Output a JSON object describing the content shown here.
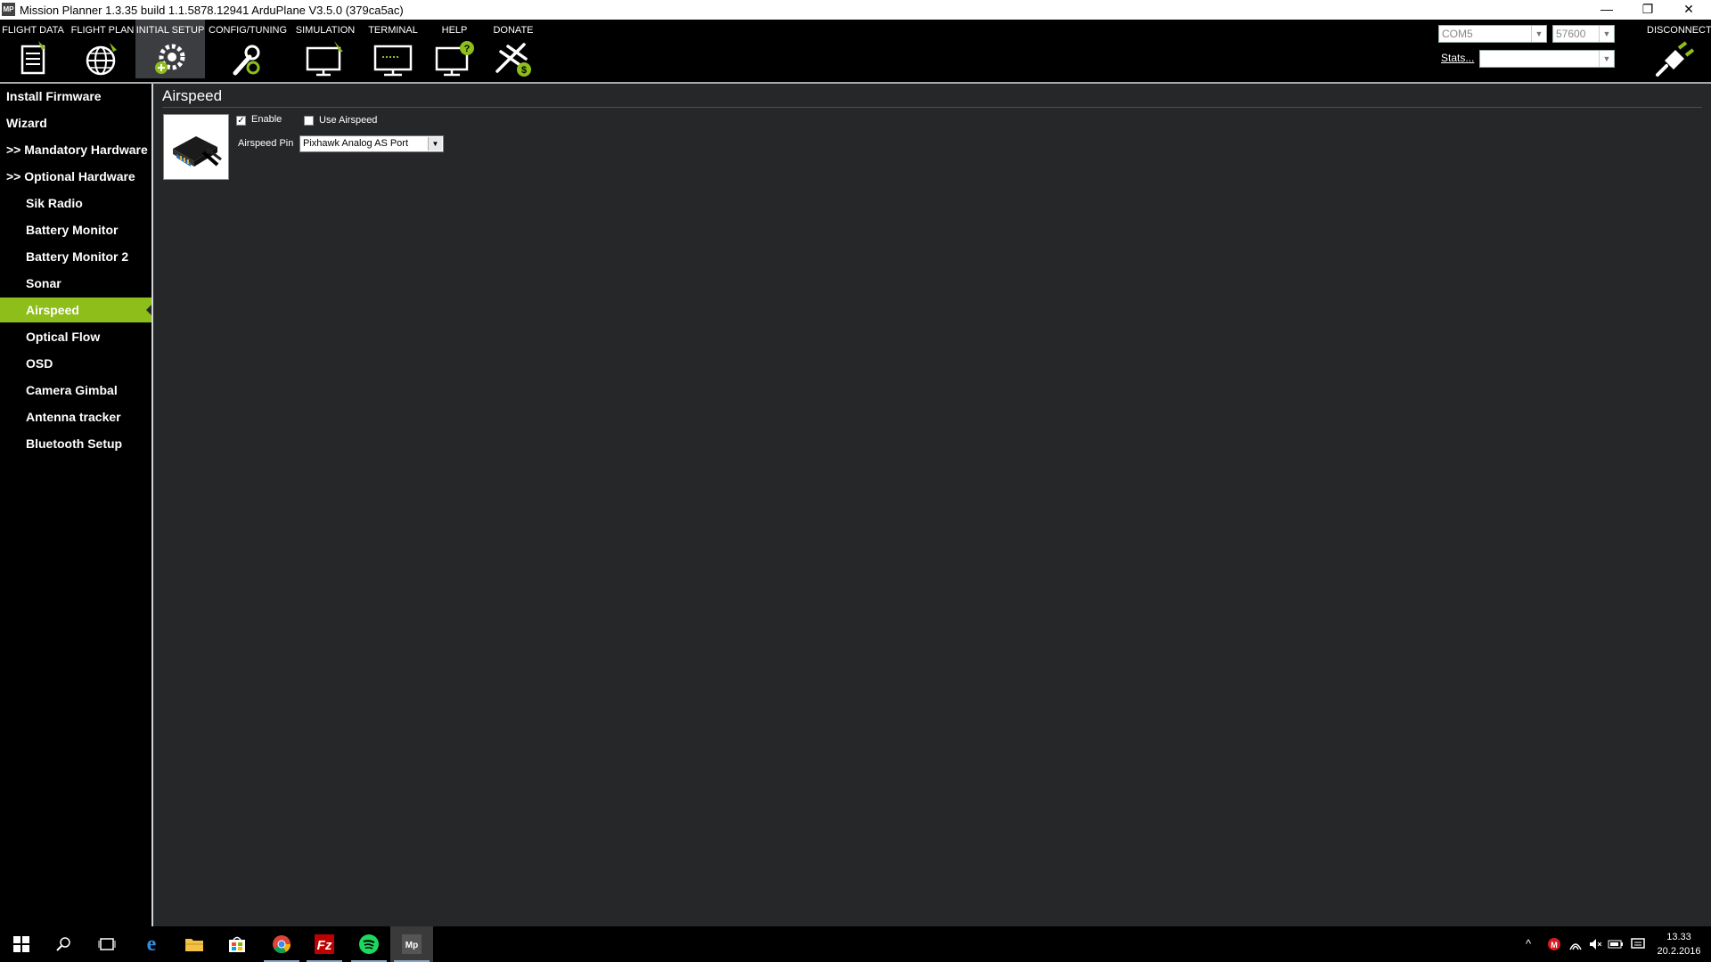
{
  "window": {
    "title": "Mission Planner 1.3.35 build 1.1.5878.12941 ArduPlane V3.5.0 (379ca5ac)",
    "app_icon_text": "MP",
    "minimize": "—",
    "restore": "❐",
    "close": "✕"
  },
  "toolbar": {
    "menu": [
      {
        "label": "FLIGHT DATA",
        "icon": "clipboard-icon"
      },
      {
        "label": "FLIGHT PLAN",
        "icon": "globe-icon"
      },
      {
        "label": "INITIAL SETUP",
        "icon": "gear-plus-icon"
      },
      {
        "label": "CONFIG/TUNING",
        "icon": "wrench-icon"
      },
      {
        "label": "SIMULATION",
        "icon": "monitor-plane-icon"
      },
      {
        "label": "TERMINAL",
        "icon": "terminal-icon"
      },
      {
        "label": "HELP",
        "icon": "help-monitor-icon"
      },
      {
        "label": "DONATE",
        "icon": "plane-dollar-icon"
      }
    ],
    "port": "COM5",
    "baud": "57600",
    "stats_label": "Stats...",
    "stats_value": "",
    "disconnect_label": "DISCONNECT"
  },
  "sidebar": {
    "items": [
      {
        "label": "Install Firmware",
        "level": "top"
      },
      {
        "label": "Wizard",
        "level": "top"
      },
      {
        "label": ">> Mandatory Hardware",
        "level": "top"
      },
      {
        "label": ">> Optional Hardware",
        "level": "top"
      },
      {
        "label": "Sik Radio",
        "level": "sub"
      },
      {
        "label": "Battery Monitor",
        "level": "sub"
      },
      {
        "label": "Battery Monitor 2",
        "level": "sub"
      },
      {
        "label": "Sonar",
        "level": "sub"
      },
      {
        "label": "Airspeed",
        "level": "sub",
        "selected": true
      },
      {
        "label": "Optical Flow",
        "level": "sub"
      },
      {
        "label": "OSD",
        "level": "sub"
      },
      {
        "label": "Camera Gimbal",
        "level": "sub"
      },
      {
        "label": "Antenna tracker",
        "level": "sub"
      },
      {
        "label": "Bluetooth Setup",
        "level": "sub"
      }
    ]
  },
  "panel": {
    "title": "Airspeed",
    "enable_label": "Enable",
    "enable_checked": true,
    "use_airspeed_label": "Use Airspeed",
    "use_airspeed_checked": false,
    "pin_label": "Airspeed Pin",
    "pin_value": "Pixhawk Analog AS Port"
  },
  "taskbar": {
    "apps": [
      "windows-start-icon",
      "search-icon",
      "task-view-icon",
      "edge-icon",
      "file-explorer-icon",
      "store-icon",
      "chrome-icon",
      "filezilla-icon",
      "spotify-icon",
      "mission-planner-icon"
    ],
    "clock_time": "13.33",
    "clock_date": "20.2.2016"
  },
  "colors": {
    "accent": "#8dbe1a",
    "background": "#262729",
    "sidebar": "#000000"
  }
}
